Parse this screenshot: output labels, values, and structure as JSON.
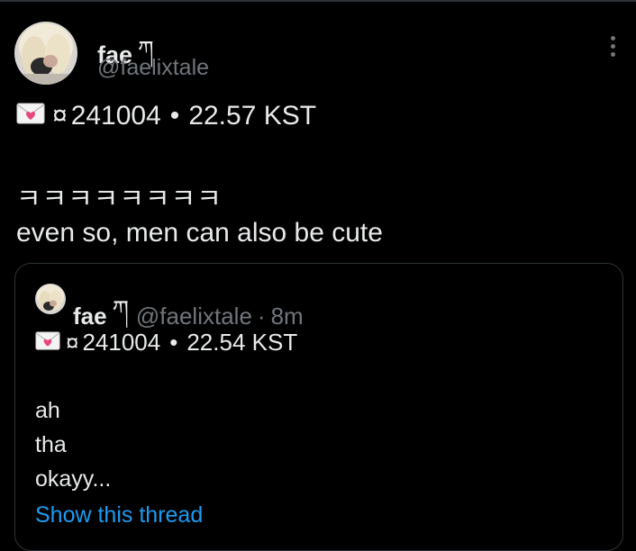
{
  "colors": {
    "background": "#000000",
    "text": "#e7e9ea",
    "secondary": "#71767b",
    "link": "#1d9bf0",
    "border": "#2f3336"
  },
  "tweet": {
    "display_name": "fae",
    "name_emoji": "ཀ",
    "handle": "@faelixtale",
    "more_icon": "more-vertical-icon",
    "meta": {
      "envelope_icon": "love-letter-icon",
      "currency_sign": "¤",
      "date": "241004",
      "bullet": "•",
      "time": "22.57 KST"
    },
    "lines": [
      "ㅋㅋㅋㅋㅋㅋㅋㅋ",
      "even so, men can also be cute"
    ]
  },
  "quoted": {
    "display_name": "fae",
    "name_emoji": "ཀ",
    "handle": "@faelixtale",
    "separator": "·",
    "relative_time": "8m",
    "meta": {
      "envelope_icon": "love-letter-icon",
      "currency_sign": "¤",
      "date": "241004",
      "bullet": "•",
      "time": "22.54 KST"
    },
    "lines": [
      "ah",
      "tha",
      "okayy..."
    ],
    "show_thread": "Show this thread"
  }
}
